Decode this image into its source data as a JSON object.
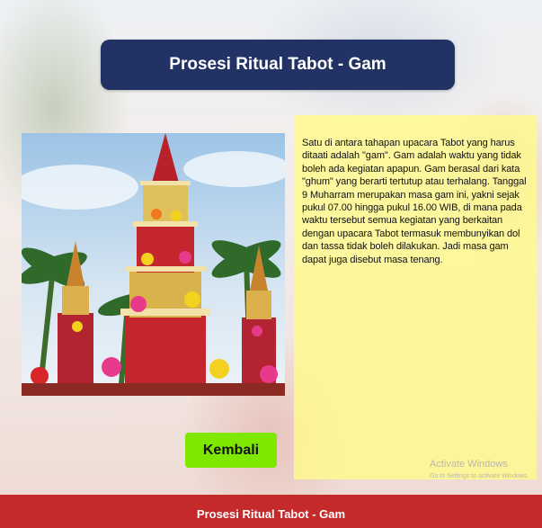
{
  "header": {
    "title": "Prosesi Ritual Tabot - Gam"
  },
  "content": {
    "description": "Satu di antara tahapan upacara Tabot yang harus ditaati adalah \"gam\". Gam adalah waktu yang tidak boleh ada kegiatan apapun. Gam berasal dari kata \"ghum\" yang berarti tertutup atau terhalang. Tanggal 9 Muharram merupakan masa gam ini, yakni sejak pukul 07.00 hingga pukul 16.00 WIB, di mana pada waktu tersebut semua kegiatan yang berkaitan dengan upacara Tabot termasuk membunyikan dol dan tassa tidak boleh dilakukan. Jadi masa gam dapat juga disebut masa tenang."
  },
  "buttons": {
    "back_label": "Kembali"
  },
  "watermark": {
    "line1": "Activate Windows",
    "line2": "Go to Settings to activate Windows."
  },
  "footer": {
    "title": "Prosesi Ritual Tabot - Gam"
  },
  "colors": {
    "title_banner": "#223264",
    "description_panel": "#fffa8c",
    "back_button": "#7fe800",
    "footer_bar": "#c52a2a"
  }
}
